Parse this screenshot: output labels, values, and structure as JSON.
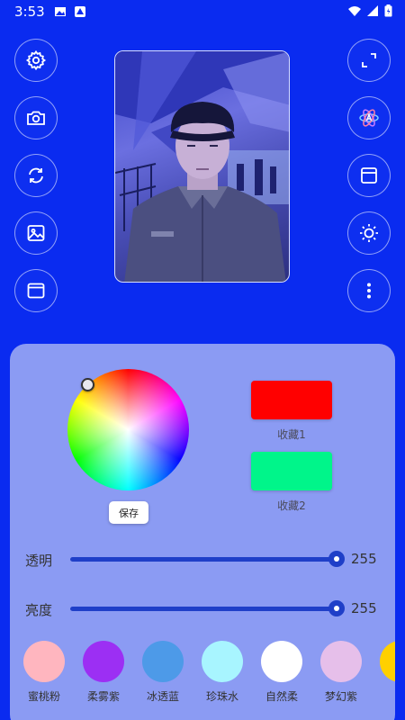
{
  "status_bar": {
    "time": "3:53"
  },
  "left_buttons": [
    {
      "icon": "gear-icon"
    },
    {
      "icon": "camera-icon"
    },
    {
      "icon": "switch-camera-icon"
    },
    {
      "icon": "image-icon"
    },
    {
      "icon": "window-icon"
    }
  ],
  "right_buttons": [
    {
      "icon": "fullscreen-icon"
    },
    {
      "icon": "atom-icon"
    },
    {
      "icon": "layout-icon"
    },
    {
      "icon": "brightness-icon"
    },
    {
      "icon": "more-vert-icon"
    }
  ],
  "color_picker": {
    "save_label": "保存",
    "favorites": [
      {
        "label": "收藏1",
        "color": "#ff0000"
      },
      {
        "label": "收藏2",
        "color": "#00f58a"
      }
    ]
  },
  "sliders": {
    "opacity": {
      "label": "透明",
      "value": "255",
      "fraction": 1.0
    },
    "brightness": {
      "label": "亮度",
      "value": "255",
      "fraction": 1.0
    }
  },
  "presets": [
    {
      "label": "蜜桃粉",
      "color": "#ffb6bf"
    },
    {
      "label": "柔雾紫",
      "color": "#9c2ff3"
    },
    {
      "label": "冰透蓝",
      "color": "#4d9ae8"
    },
    {
      "label": "珍珠水",
      "color": "#a8f5ff"
    },
    {
      "label": "自然柔",
      "color": "#ffffff"
    },
    {
      "label": "梦幻紫",
      "color": "#e6bfea"
    },
    {
      "label": "蜜",
      "color": "#ffd000"
    }
  ]
}
